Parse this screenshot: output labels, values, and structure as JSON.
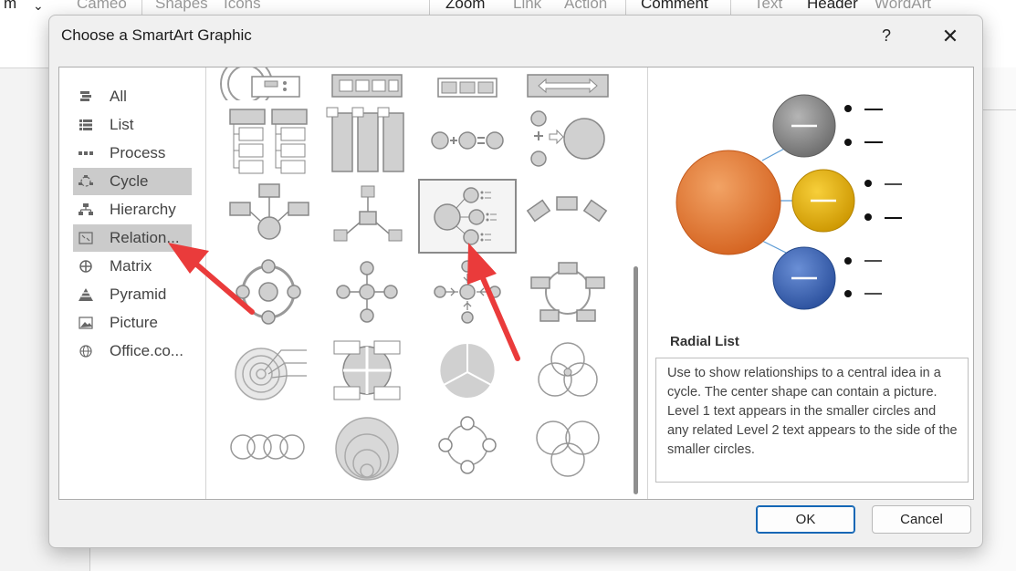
{
  "ribbon": {
    "left_text": "m",
    "chevron": "⌄",
    "items": [
      "Cameo",
      "Shapes",
      "Icons",
      "Zoom",
      "Link",
      "Action",
      "Comment",
      "Text",
      "Header",
      "WordArt"
    ]
  },
  "dialog": {
    "title": "Choose a SmartArt Graphic",
    "help_label": "?",
    "close_label": "✕",
    "ok_label": "OK",
    "cancel_label": "Cancel"
  },
  "categories": [
    {
      "label": "All",
      "icon": "all-icon"
    },
    {
      "label": "List",
      "icon": "list-icon"
    },
    {
      "label": "Process",
      "icon": "process-icon"
    },
    {
      "label": "Cycle",
      "icon": "cycle-icon",
      "selected": true
    },
    {
      "label": "Hierarchy",
      "icon": "hierarchy-icon"
    },
    {
      "label": "Relation...",
      "icon": "relationship-icon",
      "hover": true
    },
    {
      "label": "Matrix",
      "icon": "matrix-icon"
    },
    {
      "label": "Pyramid",
      "icon": "pyramid-icon"
    },
    {
      "label": "Picture",
      "icon": "picture-icon"
    },
    {
      "label": "Office.co...",
      "icon": "globe-icon"
    }
  ],
  "preview": {
    "name": "Radial List",
    "description": "Use to show relationships to a central idea in a cycle. The center shape can contain a picture. Level 1 text appears in the smaller circles and any related Level 2 text appears to the side of the smaller circles.",
    "colors": {
      "center": "#e07b39",
      "top": "#8e8e8e",
      "mid": "#e8b10a",
      "bottom": "#3d64b0"
    }
  },
  "colors": {
    "accent_ok": "#1366b5",
    "arrow": "#ea3b3b",
    "selected_bg": "#cbcbcb"
  }
}
